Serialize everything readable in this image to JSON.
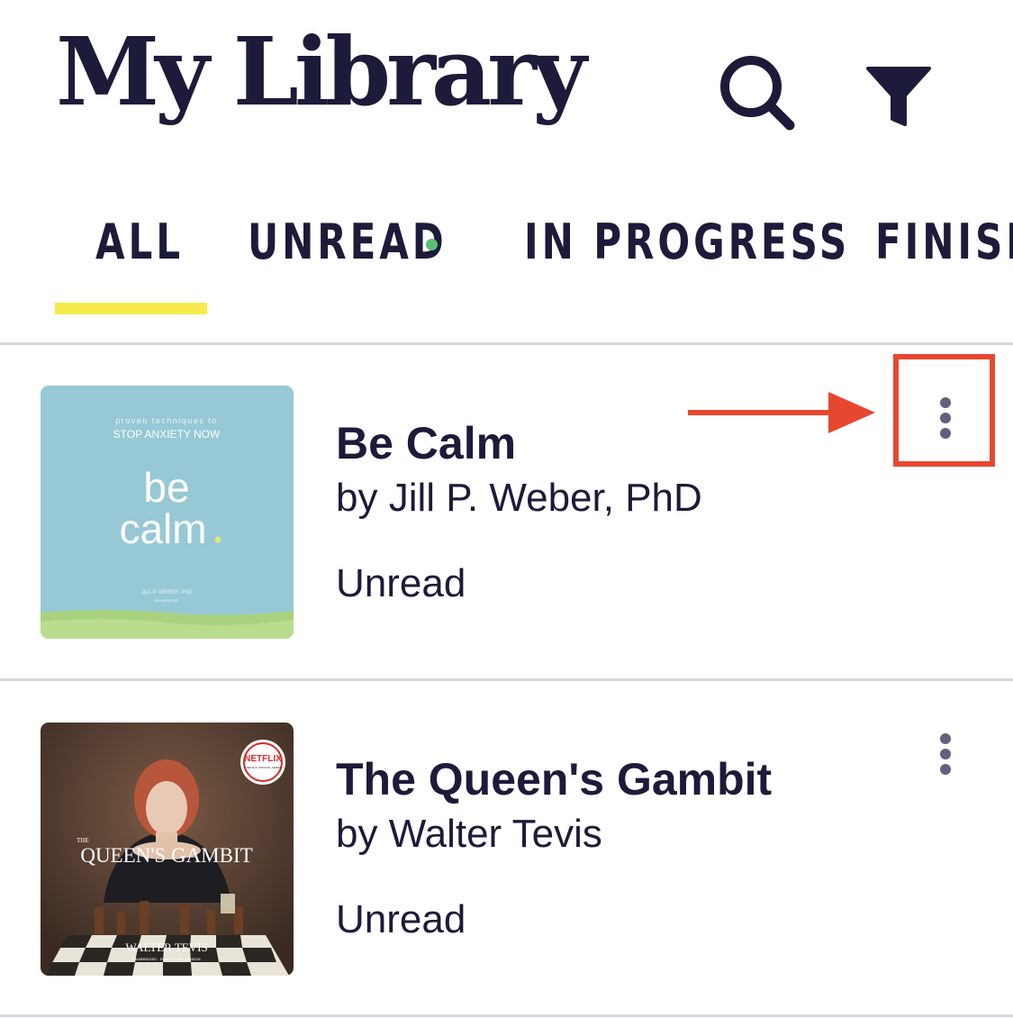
{
  "header": {
    "title": "My Library",
    "search_icon": "search-icon",
    "filter_icon": "filter-icon"
  },
  "tabs": [
    {
      "label": "ALL",
      "active": true
    },
    {
      "label": "UNREAD",
      "has_new_indicator": true
    },
    {
      "label": "IN PROGRESS"
    },
    {
      "label": "FINISHED"
    }
  ],
  "colors": {
    "text": "#1c1b3a",
    "active_tab_underline": "#f7ea4c",
    "new_indicator": "#5dbf70",
    "annotation": "#e8472f",
    "menu_dots": "#625f7f"
  },
  "books": [
    {
      "title": "Be Calm",
      "author": "by Jill P. Weber, PhD",
      "status": "Unread",
      "cover": {
        "tagline_top": "proven techniques to",
        "tagline": "STOP ANXIETY NOW",
        "title_line1": "be",
        "title_line2": "calm",
        "author": "JILL P. WEBER, PhD",
        "edition": "UNABRIDGED"
      }
    },
    {
      "title": "The Queen's Gambit",
      "author": "by Walter Tevis",
      "status": "Unread",
      "cover": {
        "badge": "NETFLIX",
        "badge_sub": "A NETFLIX ORIGINAL SERIES",
        "title_small": "THE",
        "title": "QUEEN'S GAMBIT",
        "author": "WALTER TEVIS",
        "edition": "UNABRIDGED · READ BY AMY LANDON"
      }
    }
  ],
  "annotation": {
    "target": "more-options-button",
    "shape": "arrow-and-box"
  }
}
